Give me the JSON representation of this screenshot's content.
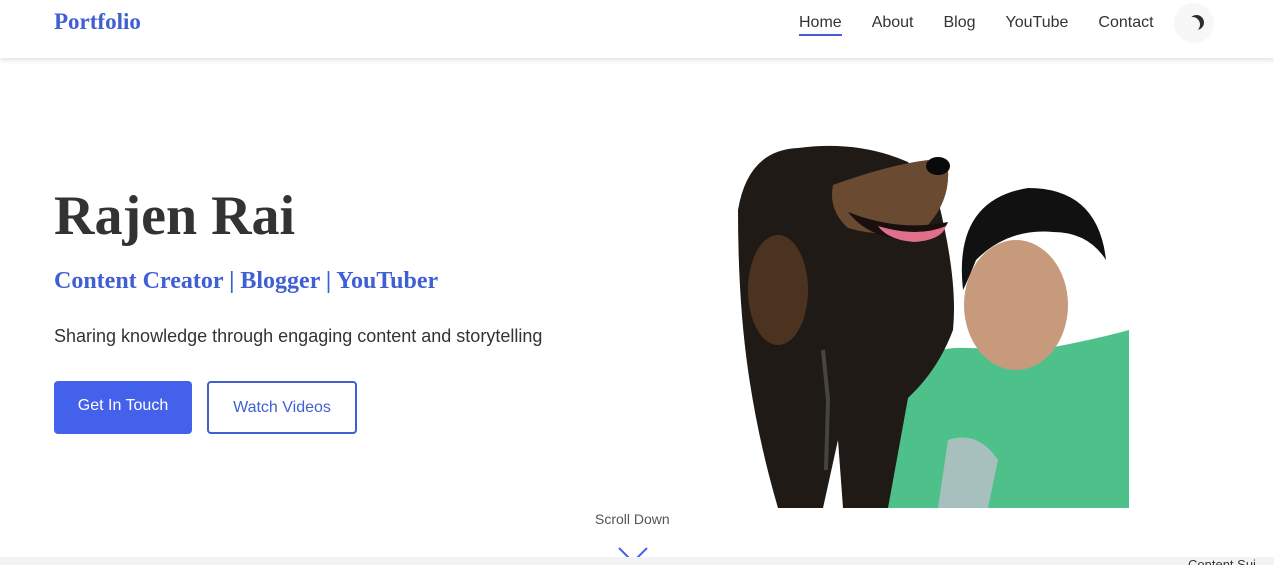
{
  "nav": {
    "logo": "Portfolio",
    "links": [
      {
        "label": "Home",
        "active": true
      },
      {
        "label": "About",
        "active": false
      },
      {
        "label": "Blog",
        "active": false
      },
      {
        "label": "YouTube",
        "active": false
      },
      {
        "label": "Contact",
        "active": false
      }
    ],
    "theme_icon": "moon-icon"
  },
  "hero": {
    "name": "Rajen Rai",
    "roles": "Content Creator | Blogger | YouTuber",
    "tagline": "Sharing knowledge through engaging content and storytelling",
    "primary_button": "Get In Touch",
    "secondary_button": "Watch Videos",
    "photo_description": "cut-out photo of a dog and a young man in a green shirt"
  },
  "scroll": {
    "label": "Scroll Down",
    "icon": "chevron-down-icon"
  },
  "footer_peek": {
    "text": "Content Sui"
  },
  "colors": {
    "accent": "#3f5fd3",
    "button_primary": "#4461ec",
    "text": "#333333"
  }
}
